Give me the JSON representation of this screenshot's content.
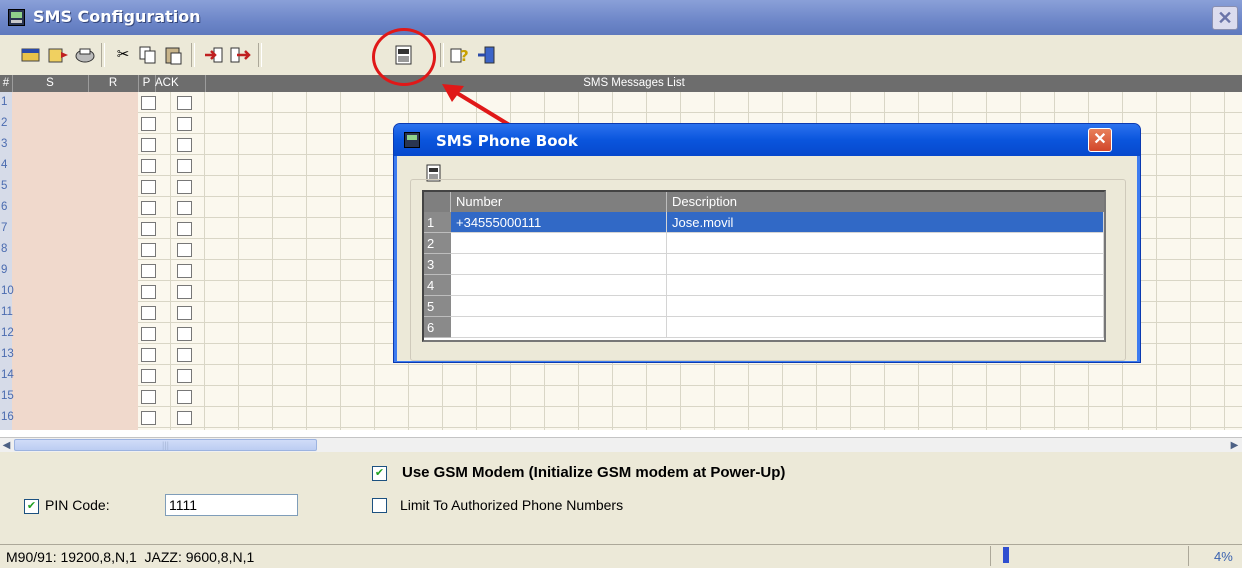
{
  "window": {
    "title": "SMS Configuration"
  },
  "grid": {
    "columns": [
      "#",
      "S",
      "R",
      "P",
      "ACK",
      "SMS Messages List"
    ],
    "rows": [
      "1",
      "2",
      "3",
      "4",
      "5",
      "6",
      "7",
      "8",
      "9",
      "10",
      "11",
      "12",
      "13",
      "14",
      "15",
      "16"
    ]
  },
  "options": {
    "use_gsm_modem": {
      "label": "Use GSM Modem (Initialize GSM modem at Power-Up)",
      "checked": true
    },
    "limit_authorized": {
      "label": "Limit To Authorized Phone Numbers",
      "checked": false
    },
    "pin_code": {
      "label": "PIN Code:",
      "value": "1111",
      "checked": true
    }
  },
  "status": {
    "text": "M90/91: 19200,8,N,1  JAZZ: 9600,8,N,1",
    "progress_percent": "4%",
    "progress_value": 4
  },
  "phone_book": {
    "title": "SMS Phone Book",
    "columns": {
      "number": "Number",
      "description": "Description"
    },
    "rows": [
      {
        "n": "1",
        "number": "+34555000111",
        "description": "Jose.movil"
      },
      {
        "n": "2",
        "number": "",
        "description": ""
      },
      {
        "n": "3",
        "number": "",
        "description": ""
      },
      {
        "n": "4",
        "number": "",
        "description": ""
      },
      {
        "n": "5",
        "number": "",
        "description": ""
      },
      {
        "n": "6",
        "number": "",
        "description": ""
      }
    ]
  },
  "colors": {
    "title_bar": "#6d86c8",
    "dialog_title": "#0a55dd",
    "selection": "#3169c6",
    "highlight_circle": "#e01818"
  }
}
